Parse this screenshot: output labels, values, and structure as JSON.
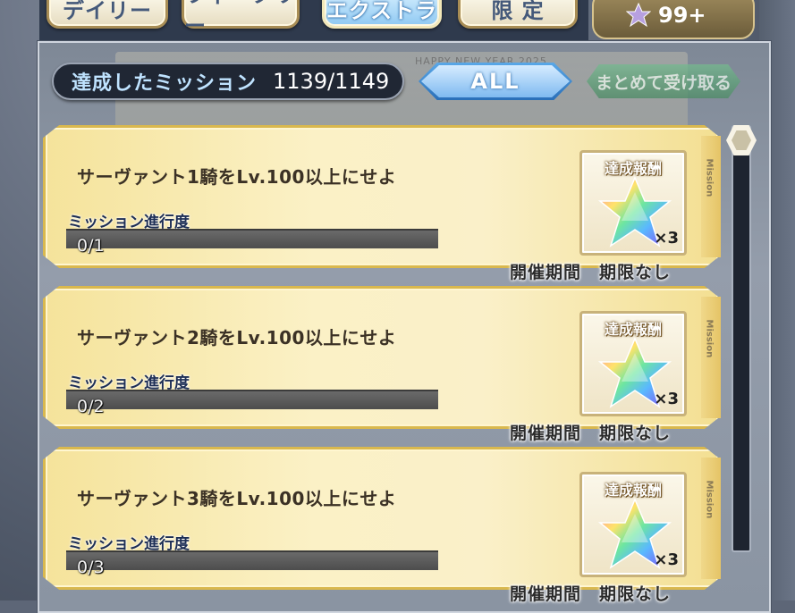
{
  "tabs": [
    {
      "label": "デイリー"
    },
    {
      "label": "ウィークリー"
    },
    {
      "label": "エクストラ",
      "active": true
    },
    {
      "label": "限 定"
    }
  ],
  "currency": {
    "value": "99+",
    "icon": "saint-quartz-icon"
  },
  "banner": {
    "text": "HAPPY NEW YEAR 2025"
  },
  "header": {
    "achieved_label": "達成したミッション",
    "achieved_count": "1139/1149",
    "filter_label": "ALL",
    "claim_all_label": "まとめて受け取る"
  },
  "missions": [
    {
      "title": "サーヴァント1騎をLv.100以上にせよ",
      "progress_label": "ミッション進行度",
      "progress_text": "0/1",
      "progress": 0,
      "reward_label": "達成報酬",
      "reward_qty": "×3",
      "period": "開催期間　期限なし",
      "tag": "Mission"
    },
    {
      "title": "サーヴァント2騎をLv.100以上にせよ",
      "progress_label": "ミッション進行度",
      "progress_text": "0/2",
      "progress": 0,
      "reward_label": "達成報酬",
      "reward_qty": "×3",
      "period": "開催期間　期限なし",
      "tag": "Mission"
    },
    {
      "title": "サーヴァント3騎をLv.100以上にせよ",
      "progress_label": "ミッション進行度",
      "progress_text": "0/3",
      "progress": 0,
      "reward_label": "達成報酬",
      "reward_qty": "×3",
      "period": "開催期間　期限なし",
      "tag": "Mission"
    }
  ],
  "colors": {
    "accent": "#4aa3e0",
    "card": "#fbf1c6",
    "tab_active": "#8fc9f2"
  }
}
